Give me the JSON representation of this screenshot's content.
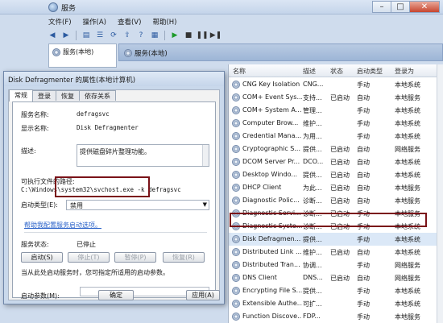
{
  "window": {
    "title": "服务"
  },
  "menu": [
    "文件(F)",
    "操作(A)",
    "查看(V)",
    "帮助(H)"
  ],
  "toolbar": {
    "icons": [
      "back-icon",
      "forward-icon",
      "show-tree-icon",
      "list-icon",
      "refresh-icon",
      "export-icon",
      "help-icon",
      "properties-icon",
      "play-icon",
      "stop-icon",
      "pause-icon",
      "restart-icon"
    ]
  },
  "tree": {
    "root": "服务(本地)"
  },
  "panel": {
    "title": "服务(本地)"
  },
  "services": {
    "columns": [
      "名称",
      "描述",
      "状态",
      "启动类型",
      "登录为"
    ],
    "rows": [
      {
        "name": "CNG Key Isolation",
        "desc": "CNG...",
        "status": "",
        "startup": "手动",
        "logon": "本地系统"
      },
      {
        "name": "COM+ Event Sys...",
        "desc": "支持...",
        "status": "已启动",
        "startup": "自动",
        "logon": "本地服务"
      },
      {
        "name": "COM+ System A...",
        "desc": "管理...",
        "status": "",
        "startup": "手动",
        "logon": "本地系统"
      },
      {
        "name": "Computer Brow...",
        "desc": "维护...",
        "status": "",
        "startup": "手动",
        "logon": "本地系统"
      },
      {
        "name": "Credential Mana...",
        "desc": "为用...",
        "status": "",
        "startup": "手动",
        "logon": "本地系统"
      },
      {
        "name": "Cryptographic S...",
        "desc": "提供...",
        "status": "已启动",
        "startup": "自动",
        "logon": "网络服务"
      },
      {
        "name": "DCOM Server Pr...",
        "desc": "DCO...",
        "status": "已启动",
        "startup": "自动",
        "logon": "本地系统"
      },
      {
        "name": "Desktop Windo...",
        "desc": "提供...",
        "status": "已启动",
        "startup": "自动",
        "logon": "本地系统"
      },
      {
        "name": "DHCP Client",
        "desc": "为此...",
        "status": "已启动",
        "startup": "自动",
        "logon": "本地服务"
      },
      {
        "name": "Diagnostic Polic...",
        "desc": "诊断...",
        "status": "已启动",
        "startup": "自动",
        "logon": "本地服务"
      },
      {
        "name": "Diagnostic Servi...",
        "desc": "诊断...",
        "status": "已启动",
        "startup": "手动",
        "logon": "本地服务"
      },
      {
        "name": "Diagnostic Syste...",
        "desc": "诊断...",
        "status": "已启动",
        "startup": "手动",
        "logon": "本地系统"
      },
      {
        "name": "Disk Defragmen...",
        "desc": "提供...",
        "status": "",
        "startup": "手动",
        "logon": "本地系统"
      },
      {
        "name": "Distributed Link ...",
        "desc": "维护...",
        "status": "已启动",
        "startup": "自动",
        "logon": "本地系统"
      },
      {
        "name": "Distributed Tran...",
        "desc": "协调...",
        "status": "",
        "startup": "手动",
        "logon": "网络服务"
      },
      {
        "name": "DNS Client",
        "desc": "DNS...",
        "status": "已启动",
        "startup": "自动",
        "logon": "网络服务"
      },
      {
        "name": "Encrypting File S...",
        "desc": "提供...",
        "status": "",
        "startup": "手动",
        "logon": "本地系统"
      },
      {
        "name": "Extensible Authe...",
        "desc": "可扩...",
        "status": "",
        "startup": "手动",
        "logon": "本地系统"
      },
      {
        "name": "Function Discove...",
        "desc": "FDP...",
        "status": "",
        "startup": "手动",
        "logon": "本地服务"
      }
    ]
  },
  "dialog": {
    "title": "Disk Defragmenter 的属性(本地计算机)",
    "tabs": [
      "常规",
      "登录",
      "恢复",
      "依存关系"
    ],
    "service_name_label": "服务名称:",
    "service_name": "defragsvc",
    "display_name_label": "显示名称:",
    "display_name": "Disk Defragmenter",
    "description_label": "描述:",
    "description": "提供磁盘碎片整理功能。",
    "path_label": "可执行文件的路径:",
    "path": "C:\\Windows\\system32\\svchost.exe -k defragsvc",
    "startup_type_label": "启动类型(E):",
    "startup_type": "禁用",
    "help_link": "帮助我配置服务启动选项。",
    "status_label": "服务状态:",
    "status": "已停止",
    "btn_start": "启动(S)",
    "btn_stop": "停止(T)",
    "btn_pause": "暂停(P)",
    "btn_resume": "恢复(R)",
    "hint": "当从此处启动服务时，您可指定所适用的启动参数。",
    "params_label": "启动参数(M):",
    "params_value": "",
    "btn_ok": "确定",
    "btn_apply": "应用(A)"
  },
  "accent": {
    "highlight": "#7a1218",
    "selection": "#dbe8f7"
  }
}
